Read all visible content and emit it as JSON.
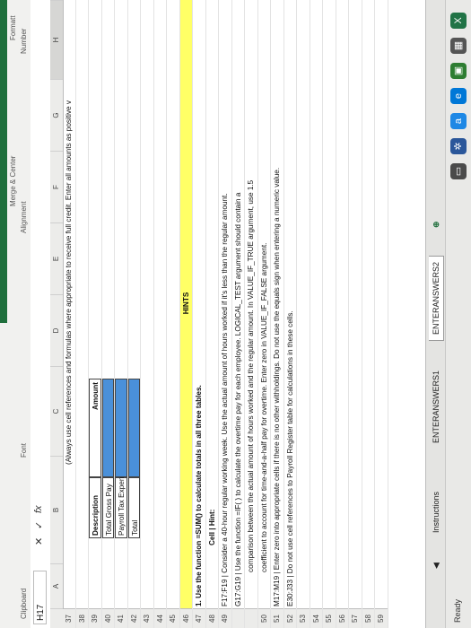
{
  "ribbon": {
    "clipboard": "Clipboard",
    "font": "Font",
    "alignment": "Alignment",
    "number": "Number",
    "merge": "Merge & Center",
    "formula": "Formatt"
  },
  "formula_bar": {
    "name_box": "H17",
    "fx": "fx",
    "cancel": "✕",
    "enter": "✓"
  },
  "columns": [
    "A",
    "B",
    "C",
    "D",
    "E",
    "F",
    "G",
    "H"
  ],
  "rows": {
    "r37": {
      "num": "37",
      "text": "(Always use cell references and formulas where appropriate to receive full credit. Enter all amounts as positive v"
    },
    "r38": {
      "num": "38"
    },
    "r39": {
      "num": "39",
      "desc": "Description",
      "amt": "Amount"
    },
    "r40": {
      "num": "40",
      "desc": "Total Gross Pay"
    },
    "r41": {
      "num": "41",
      "desc": "Payroll Tax Expense"
    },
    "r42": {
      "num": "42",
      "desc": "Total"
    },
    "r43": {
      "num": "43"
    },
    "r44": {
      "num": "44"
    },
    "r45": {
      "num": "45"
    },
    "r46": {
      "num": "46",
      "text": "HINTS"
    },
    "r47": {
      "num": "47",
      "text": "1. Use the function =SUM() to calculate totals in all three tables."
    },
    "r48": {
      "num": "48",
      "text": "Cell | Hint:"
    },
    "r49": {
      "num": "49",
      "text": "F17:F19 | Consider a 40-hour regular working week. Use the actual amount of hours worked if it's less than the regular amount."
    },
    "r49b": {
      "text": "G17:G19 | Use the function =IF( ) to calculate the overtime pay for each employee. LOGICAL_TEST argument should contain a"
    },
    "r49c": {
      "text": "comparison between the actual amount of hours worked and the regular amount. In VALUE_IF_TRUE argument, use 1.5"
    },
    "r50": {
      "num": "50",
      "text": "coefficient to account for time-and-a-half pay for overtime. Enter zero in VALUE_IF_FALSE argument."
    },
    "r51": {
      "num": "51",
      "text": "M17:M19 | Enter zero into appropriate cells if there is no other withholdings. Do not use the equals sign when entering a numeric value."
    },
    "r52": {
      "num": "52",
      "text": "E30:J33 | Do not use cell references to Payroll Register table for calculations in these cells."
    },
    "r53": {
      "num": "53"
    },
    "r54": {
      "num": "54"
    },
    "r55": {
      "num": "55"
    },
    "r56": {
      "num": "56"
    },
    "r57": {
      "num": "57"
    },
    "r58": {
      "num": "58"
    },
    "r59": {
      "num": "59"
    }
  },
  "tabs": [
    {
      "label": "Instructions"
    },
    {
      "label": "ENTERANSWERS1"
    },
    {
      "label": "ENTERANSWERS2"
    }
  ],
  "status": {
    "ready": "Ready"
  }
}
